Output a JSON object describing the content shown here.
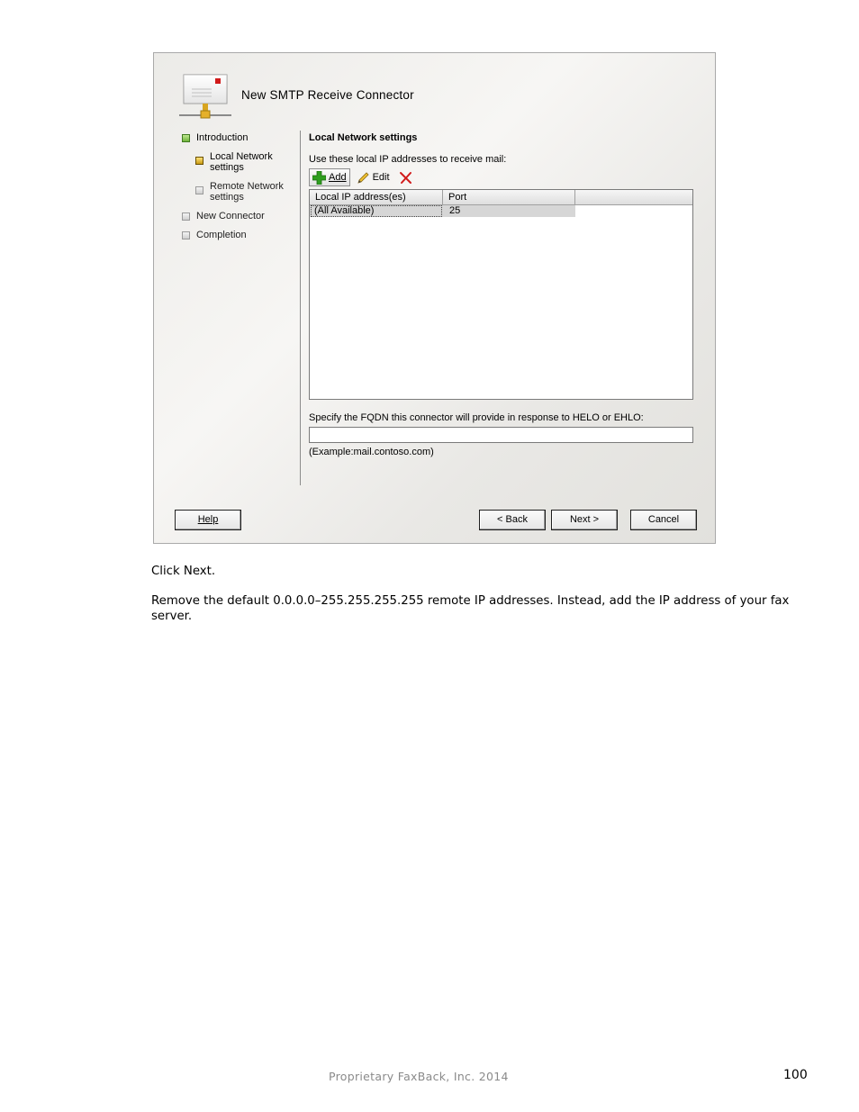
{
  "dialog": {
    "title": "New SMTP Receive Connector",
    "steps": [
      {
        "label": "Introduction",
        "state": "done"
      },
      {
        "label": "Local Network settings",
        "state": "current"
      },
      {
        "label": "Remote Network settings",
        "state": "pending"
      },
      {
        "label": "New Connector",
        "state": "pending"
      },
      {
        "label": "Completion",
        "state": "pending"
      }
    ],
    "section_title": "Local Network settings",
    "description": "Use these local IP addresses to receive mail:",
    "toolbar": {
      "add_label": "Add",
      "edit_label": "Edit"
    },
    "grid": {
      "columns": [
        "Local IP address(es)",
        "Port"
      ],
      "rows": [
        {
          "ip": "(All Available)",
          "port": "25"
        }
      ]
    },
    "fqdn_label": "Specify the FQDN this connector will provide in response to HELO or EHLO:",
    "fqdn_value": "",
    "example": "(Example:mail.contoso.com)",
    "buttons": {
      "help": "Help",
      "back": "< Back",
      "next": "Next >",
      "cancel": "Cancel"
    },
    "colors": {
      "done_step": "#6fb33b",
      "current_step": "#c99a12",
      "delete_icon": "#d11a1a",
      "add_icon": "#2f9e1f"
    }
  },
  "document": {
    "paragraph1": "Click Next.",
    "paragraph2": "Remove the default 0.0.0.0–255.255.255.255 remote IP addresses. Instead, add the IP address of your fax server.",
    "footer": "Proprietary FaxBack, Inc. 2014",
    "page_number": "100"
  }
}
